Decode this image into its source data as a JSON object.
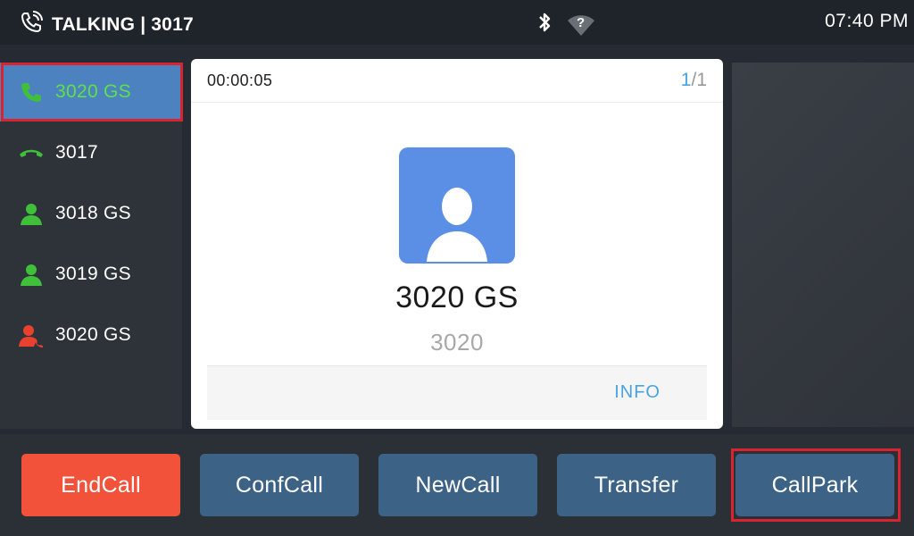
{
  "statusbar": {
    "title": "TALKING | 3017",
    "time": "07:40 PM",
    "wifi_status": "?",
    "icons": [
      "phone-call-icon",
      "bluetooth-icon",
      "wifi-icon"
    ]
  },
  "lines": [
    {
      "label": "3020 GS",
      "icon": "phone-green-icon",
      "active": true
    },
    {
      "label": "3017",
      "icon": "phone-hangup-green-icon",
      "active": false
    },
    {
      "label": "3018 GS",
      "icon": "contact-green-icon",
      "active": false
    },
    {
      "label": "3019 GS",
      "icon": "contact-green-icon",
      "active": false
    },
    {
      "label": "3020 GS",
      "icon": "contact-red-icon",
      "active": false
    }
  ],
  "call": {
    "timer": "00:00:05",
    "page_current": "1",
    "page_total": "/1",
    "name": "3020 GS",
    "number": "3020",
    "info_label": "INFO"
  },
  "buttons": {
    "end_call": "EndCall",
    "conf_call": "ConfCall",
    "new_call": "NewCall",
    "transfer": "Transfer",
    "call_park": "CallPark"
  },
  "colors": {
    "accent_blue": "#4d82c0",
    "button_blue": "#3c6286",
    "end_call_red": "#f2523a",
    "highlight_red": "#d9232e",
    "online_green": "#5ee04a"
  }
}
